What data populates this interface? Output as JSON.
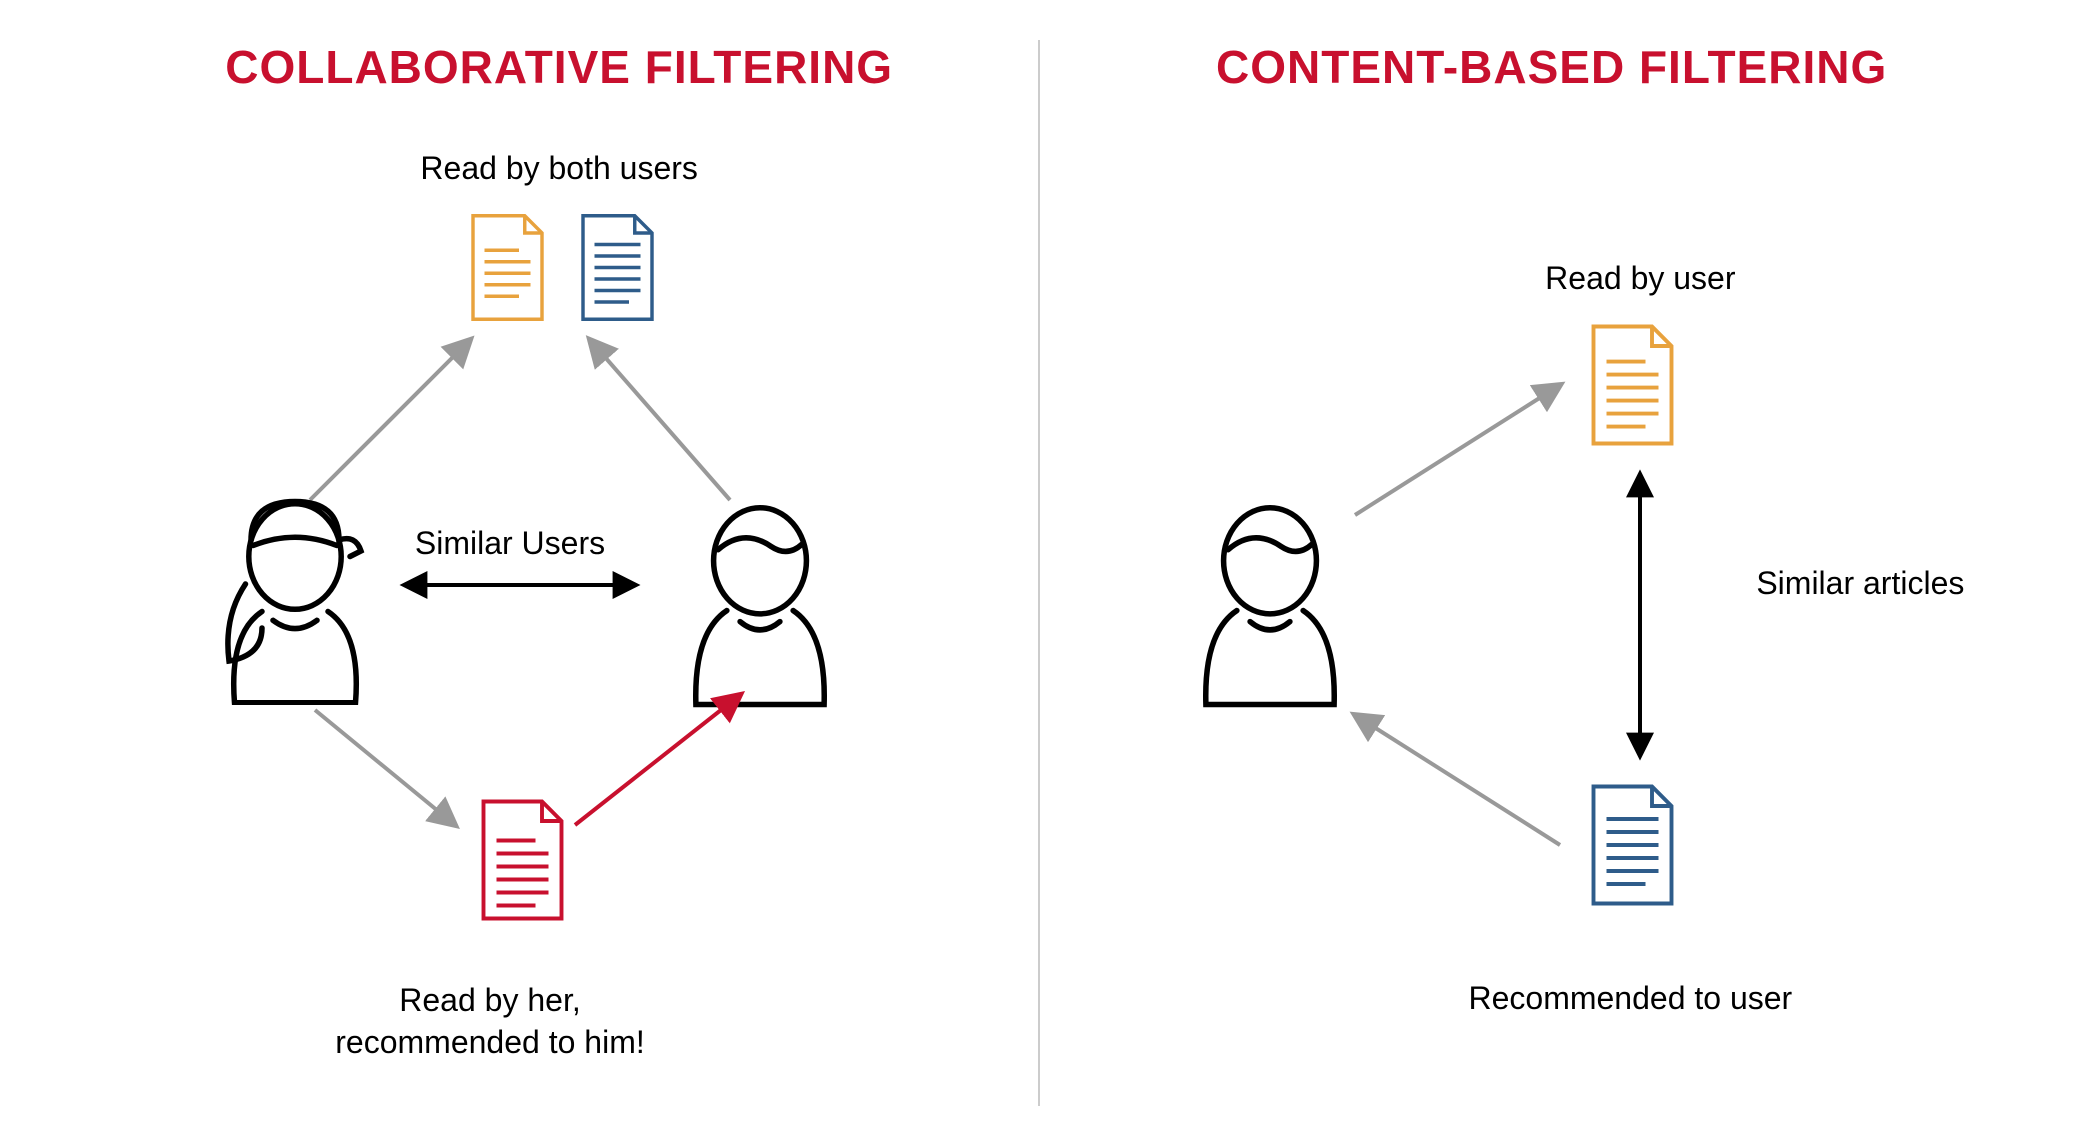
{
  "colors": {
    "red": "#C8102E",
    "orange": "#E8A23D",
    "blue": "#2E5C8A",
    "gray": "#999999",
    "black": "#000000"
  },
  "left": {
    "title": "COLLABORATIVE FILTERING",
    "top_caption": "Read by both users",
    "similar_label": "Similar Users",
    "bottom_caption_line1": "Read by her,",
    "bottom_caption_line2": "recommended to him!"
  },
  "right": {
    "title": "CONTENT-BASED FILTERING",
    "top_caption": "Read by user",
    "similar_label": "Similar articles",
    "bottom_caption": "Recommended to user"
  }
}
